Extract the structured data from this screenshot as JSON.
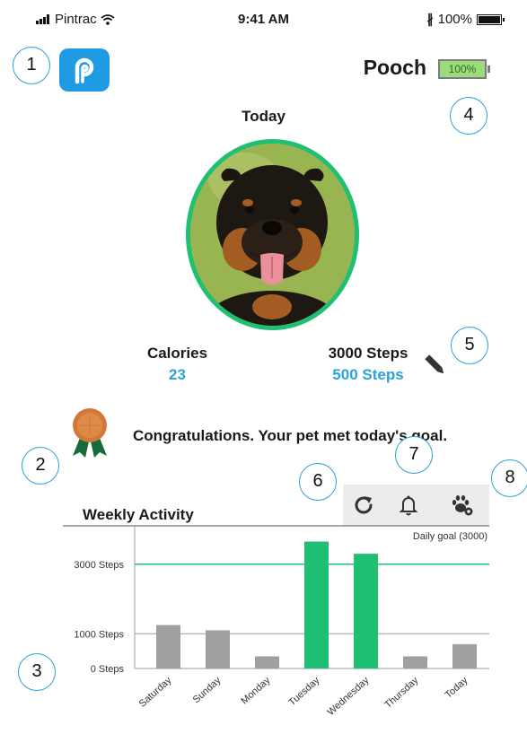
{
  "status_bar": {
    "carrier": "Pintrac",
    "time": "9:41 AM",
    "battery": "100%"
  },
  "header": {
    "pet_name": "Pooch",
    "pet_battery": "100%"
  },
  "period_label": "Today",
  "stats": {
    "calories_label": "Calories",
    "calories_value": "23",
    "steps_goal": "3000 Steps",
    "steps_value": "500 Steps"
  },
  "achievement": {
    "message": "Congratulations. Your pet met today's goal."
  },
  "weekly": {
    "title": "Weekly Activity"
  },
  "callouts": [
    "1",
    "2",
    "3",
    "4",
    "5",
    "6",
    "7",
    "8"
  ],
  "icons": {
    "app_logo": "pintrac-logo-icon",
    "refresh": "refresh-icon",
    "notifications": "bell-icon",
    "pet_settings": "paw-settings-icon",
    "edit": "pencil-icon",
    "medal": "medal-icon"
  },
  "colors": {
    "accent": "#2aa3d8",
    "goal_met": "#1fbf74",
    "below_goal": "#a0a0a0",
    "logo": "#1e9be2"
  },
  "chart_data": {
    "type": "bar",
    "categories": [
      "Saturday",
      "Sunday",
      "Monday",
      "Tuesday",
      "Wednesday",
      "Thursday",
      "Today"
    ],
    "values": [
      1250,
      1100,
      350,
      3650,
      3300,
      350,
      700
    ],
    "met_goal": [
      false,
      false,
      false,
      true,
      true,
      false,
      false
    ],
    "goal": 3000,
    "goal_label": "Daily goal (3000)",
    "y_ticks": [
      {
        "value": 0,
        "label": "0 Steps"
      },
      {
        "value": 1000,
        "label": "1000 Steps"
      },
      {
        "value": 3000,
        "label": "3000 Steps"
      }
    ],
    "ylim": [
      0,
      4000
    ],
    "title": "Weekly Activity"
  }
}
